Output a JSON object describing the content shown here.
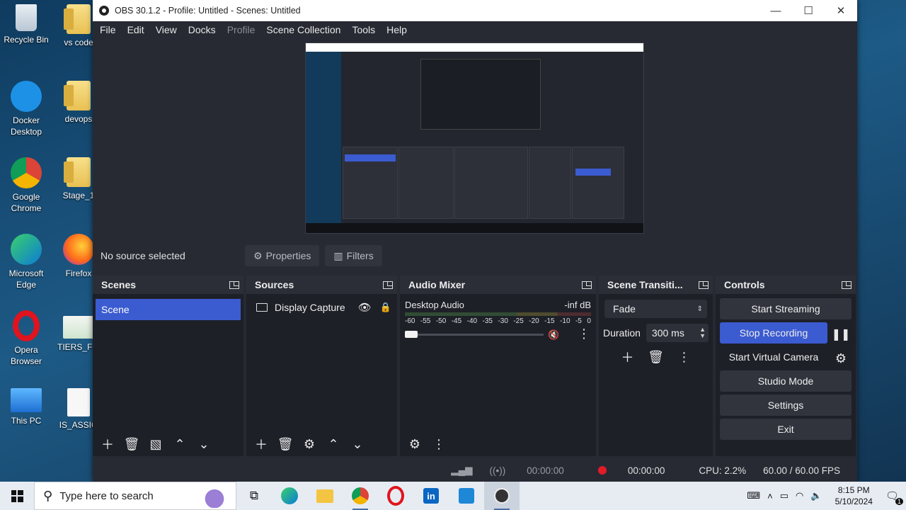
{
  "desktop": {
    "icons": [
      {
        "label": "Recycle Bin"
      },
      {
        "label": "vs code"
      },
      {
        "label": "Docker Desktop"
      },
      {
        "label": "devops"
      },
      {
        "label": "Google Chrome"
      },
      {
        "label": "Stage_1"
      },
      {
        "label": "Microsoft Edge"
      },
      {
        "label": "Firefox"
      },
      {
        "label": "Opera Browser"
      },
      {
        "label": "TIERS_For"
      },
      {
        "label": "This PC"
      },
      {
        "label": "IS_ASSIG"
      }
    ]
  },
  "window": {
    "title": "OBS 30.1.2 - Profile: Untitled - Scenes: Untitled",
    "controls": {
      "minimize": "—",
      "maximize": "☐",
      "close": "✕"
    }
  },
  "menu": {
    "items": [
      {
        "label": "File",
        "enabled": true
      },
      {
        "label": "Edit",
        "enabled": true
      },
      {
        "label": "View",
        "enabled": true
      },
      {
        "label": "Docks",
        "enabled": true
      },
      {
        "label": "Profile",
        "enabled": false
      },
      {
        "label": "Scene Collection",
        "enabled": true
      },
      {
        "label": "Tools",
        "enabled": true
      },
      {
        "label": "Help",
        "enabled": true
      }
    ]
  },
  "source_toolbar": {
    "no_source": "No source selected",
    "properties": "Properties",
    "filters": "Filters"
  },
  "scenes": {
    "title": "Scenes",
    "items": [
      "Scene"
    ]
  },
  "sources": {
    "title": "Sources",
    "items": [
      {
        "name": "Display Capture",
        "visible": true,
        "locked": false
      }
    ]
  },
  "audio_mixer": {
    "title": "Audio Mixer",
    "channel": "Desktop Audio",
    "level": "-inf dB",
    "ticks": [
      "-60",
      "-55",
      "-50",
      "-45",
      "-40",
      "-35",
      "-30",
      "-25",
      "-20",
      "-15",
      "-10",
      "-5",
      "0"
    ],
    "muted": true
  },
  "transitions": {
    "title": "Scene Transiti...",
    "selected": "Fade",
    "duration_label": "Duration",
    "duration_value": "300 ms"
  },
  "controls": {
    "title": "Controls",
    "start_streaming": "Start Streaming",
    "stop_recording": "Stop Recording",
    "start_virtual_camera": "Start Virtual Camera",
    "studio_mode": "Studio Mode",
    "settings": "Settings",
    "exit": "Exit"
  },
  "status": {
    "stream_time": "00:00:00",
    "rec_time": "00:00:00",
    "cpu": "CPU: 2.2%",
    "fps": "60.00 / 60.00 FPS"
  },
  "taskbar": {
    "search_placeholder": "Type here to search",
    "time": "8:15 PM",
    "date": "5/10/2024",
    "notifications": "1"
  },
  "colors": {
    "accent": "#3b5bd0",
    "record": "#e21b26",
    "panel_bg": "#1e2028",
    "window_bg": "#272a33"
  }
}
